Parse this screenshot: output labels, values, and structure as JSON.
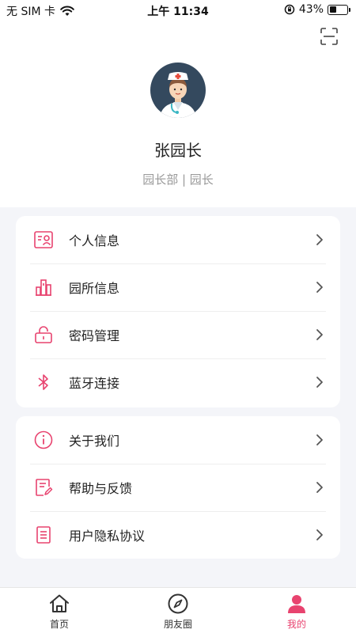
{
  "status_bar": {
    "carrier": "无 SIM 卡",
    "time": "上午 11:34",
    "battery_percent": "43%",
    "battery_level": 0.43
  },
  "profile": {
    "name": "张园长",
    "role": "园长部 | 园长"
  },
  "menu_group_1": [
    {
      "label": "个人信息",
      "icon": "id-card-icon"
    },
    {
      "label": "园所信息",
      "icon": "buildings-icon"
    },
    {
      "label": "密码管理",
      "icon": "lock-icon"
    },
    {
      "label": "蓝牙连接",
      "icon": "bluetooth-icon"
    }
  ],
  "menu_group_2": [
    {
      "label": "关于我们",
      "icon": "info-icon"
    },
    {
      "label": "帮助与反馈",
      "icon": "feedback-icon"
    },
    {
      "label": "用户隐私协议",
      "icon": "document-icon"
    }
  ],
  "tab_bar": {
    "items": [
      {
        "label": "首页",
        "icon": "home-icon"
      },
      {
        "label": "朋友圈",
        "icon": "compass-icon"
      },
      {
        "label": "我的",
        "icon": "user-icon",
        "active": true
      }
    ]
  },
  "colors": {
    "accent": "#e8436f",
    "background": "#f4f5f9"
  }
}
